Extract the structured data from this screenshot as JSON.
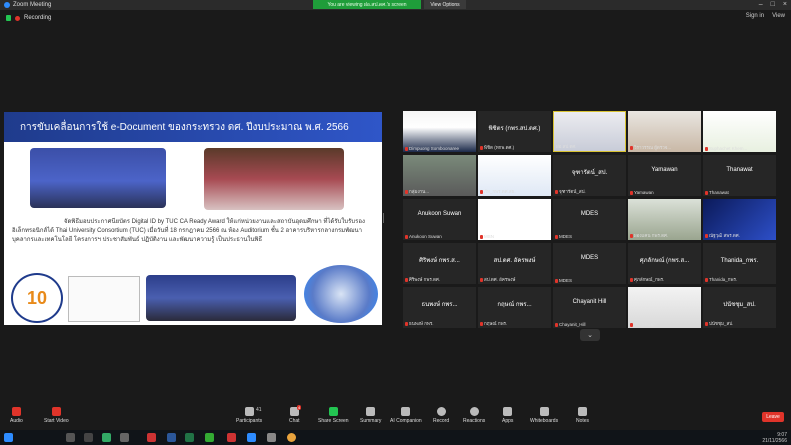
{
  "window": {
    "title": "Zoom Meeting",
    "controls": [
      "–",
      "□",
      "×"
    ]
  },
  "banner": {
    "share_text": "You are viewing ฝอ.สป.ดศ.'s screen",
    "view_options": "View Options"
  },
  "recording": {
    "label": "Recording"
  },
  "top_right": {
    "sign_in": "Sign in",
    "view": "View"
  },
  "slide": {
    "title": "การขับเคลื่อนการใช้ e-Document ของกระทรวง ดศ. ปีงบประมาณ พ.ศ. 2566",
    "body": "จัดพิธีมอบประกาศนียบัตร Digital ID by TUC CA Ready Award ให้แก่หน่วยงานและสถาบันอุดมศึกษา ที่ได้รับใบรับรองอิเล็กทรอนิกส์ได้ Thai University Consortium (TUC) เมื่อวันที่ 18 กรกฎาคม 2566 ณ ห้อง Auditorium ชั้น 2 อาคารบริหารกลางกรมพัฒนาบุคลากรและเทคโนโลยี โครงการฯ ประชาสัมพันธ์ ปฏิบัติงาน และพัฒนาความรู้ เป็นประธานในพิธี",
    "logo_text": "UNIVERSITY CONSORTIUM",
    "logo_number": "10"
  },
  "gallery": [
    {
      "big": "",
      "small": "Dimpuong Somboonaree",
      "mic_off": true,
      "video": "person1"
    },
    {
      "big": "พิชิตร (กพร.สป.ดศ.)",
      "small": "พิชิต (ทกพ.ดศ.)",
      "mic_off": true,
      "video": ""
    },
    {
      "big": "",
      "small": "ฝอ.สป.ดศ.",
      "mic_off": false,
      "video": "room",
      "active": true
    },
    {
      "big": "",
      "small": "วิราวรรณ ผู้ตรวจ...",
      "mic_off": true,
      "video": "person2"
    },
    {
      "big": "",
      "small": "Suphachet Khem...",
      "mic_off": true,
      "video": "logo"
    },
    {
      "big": "",
      "small": "กลุ่มงาน...",
      "mic_off": true,
      "video": "room2"
    },
    {
      "big": "",
      "small": "ภัท_กพร.ดศ.สธ.",
      "mic_off": true,
      "video": "slide"
    },
    {
      "big": "จุฑารัตน์_สป.",
      "small": "จุฑารัตน์_สป.",
      "mic_off": true,
      "video": ""
    },
    {
      "big": "Yamawan",
      "small": "Yamawan",
      "mic_off": true,
      "video": ""
    },
    {
      "big": "Thanawat",
      "small": "Thanawat",
      "mic_off": true,
      "video": ""
    },
    {
      "big": "Anukoon Suwan",
      "small": "Anukoon Suwan",
      "mic_off": true,
      "video": ""
    },
    {
      "big": "",
      "small": "MSN",
      "mic_off": true,
      "video": "msn"
    },
    {
      "big": "MDES",
      "small": "MDES",
      "mic_off": true,
      "video": ""
    },
    {
      "big": "",
      "small": "ผองแคน กพร.ดศ.",
      "mic_off": true,
      "video": "person3"
    },
    {
      "big": "",
      "small": "ณัฐวุฒิ สพร.ดศ.",
      "mic_off": true,
      "video": "slide2"
    },
    {
      "big": "ศิริพงษ์ กพร.ส...",
      "small": "ศิริพงษ์ กพร.ดศ.",
      "mic_off": true,
      "video": ""
    },
    {
      "big": "สป.ดศ. อัครพงษ์",
      "small": "สป.ดศ. อัครพงษ์",
      "mic_off": true,
      "video": ""
    },
    {
      "big": "MDES",
      "small": "MDES",
      "mic_off": true,
      "video": ""
    },
    {
      "big": "ศุภลักษณ์ (กพร.ส...",
      "small": "ศุภลักษณ์_กพร.",
      "mic_off": true,
      "video": ""
    },
    {
      "big": "Thanida_กพร.",
      "small": "Thanida_กพร.",
      "mic_off": true,
      "video": ""
    },
    {
      "big": "ธนพงษ์ กพร...",
      "small": "ธนพงษ์ กพร.",
      "mic_off": true,
      "video": ""
    },
    {
      "big": "กฤษณ์ กพร...",
      "small": "กฤษณ์ กพร.",
      "mic_off": true,
      "video": ""
    },
    {
      "big": "Chayanit Hill",
      "small": "Chayanit_Hill",
      "mic_off": true,
      "video": ""
    },
    {
      "big": "",
      "small": "Siri Suwan",
      "mic_off": true,
      "video": "person4"
    },
    {
      "big": "ปนัชชุม_สป.",
      "small": "ปนัชชุม_สป.",
      "mic_off": true,
      "video": ""
    }
  ],
  "toolbar": {
    "audio": "Audio",
    "start_video": "Start Video",
    "participants": "Participants",
    "participants_count": "41",
    "chat": "Chat",
    "chat_badge": "4",
    "share_screen": "Share Screen",
    "summary": "Summary",
    "ai_companion": "AI Companion",
    "record": "Record",
    "reactions": "Reactions",
    "apps": "Apps",
    "whiteboards": "Whiteboards",
    "notes": "Notes",
    "leave": "Leave"
  },
  "taskbar": {
    "time": "9:07",
    "date": "21/11/2566"
  },
  "colors": {
    "accent_blue": "#2d8cff",
    "green": "#23c552",
    "red": "#e0342a",
    "slide_blue": "#1f3b8c"
  }
}
